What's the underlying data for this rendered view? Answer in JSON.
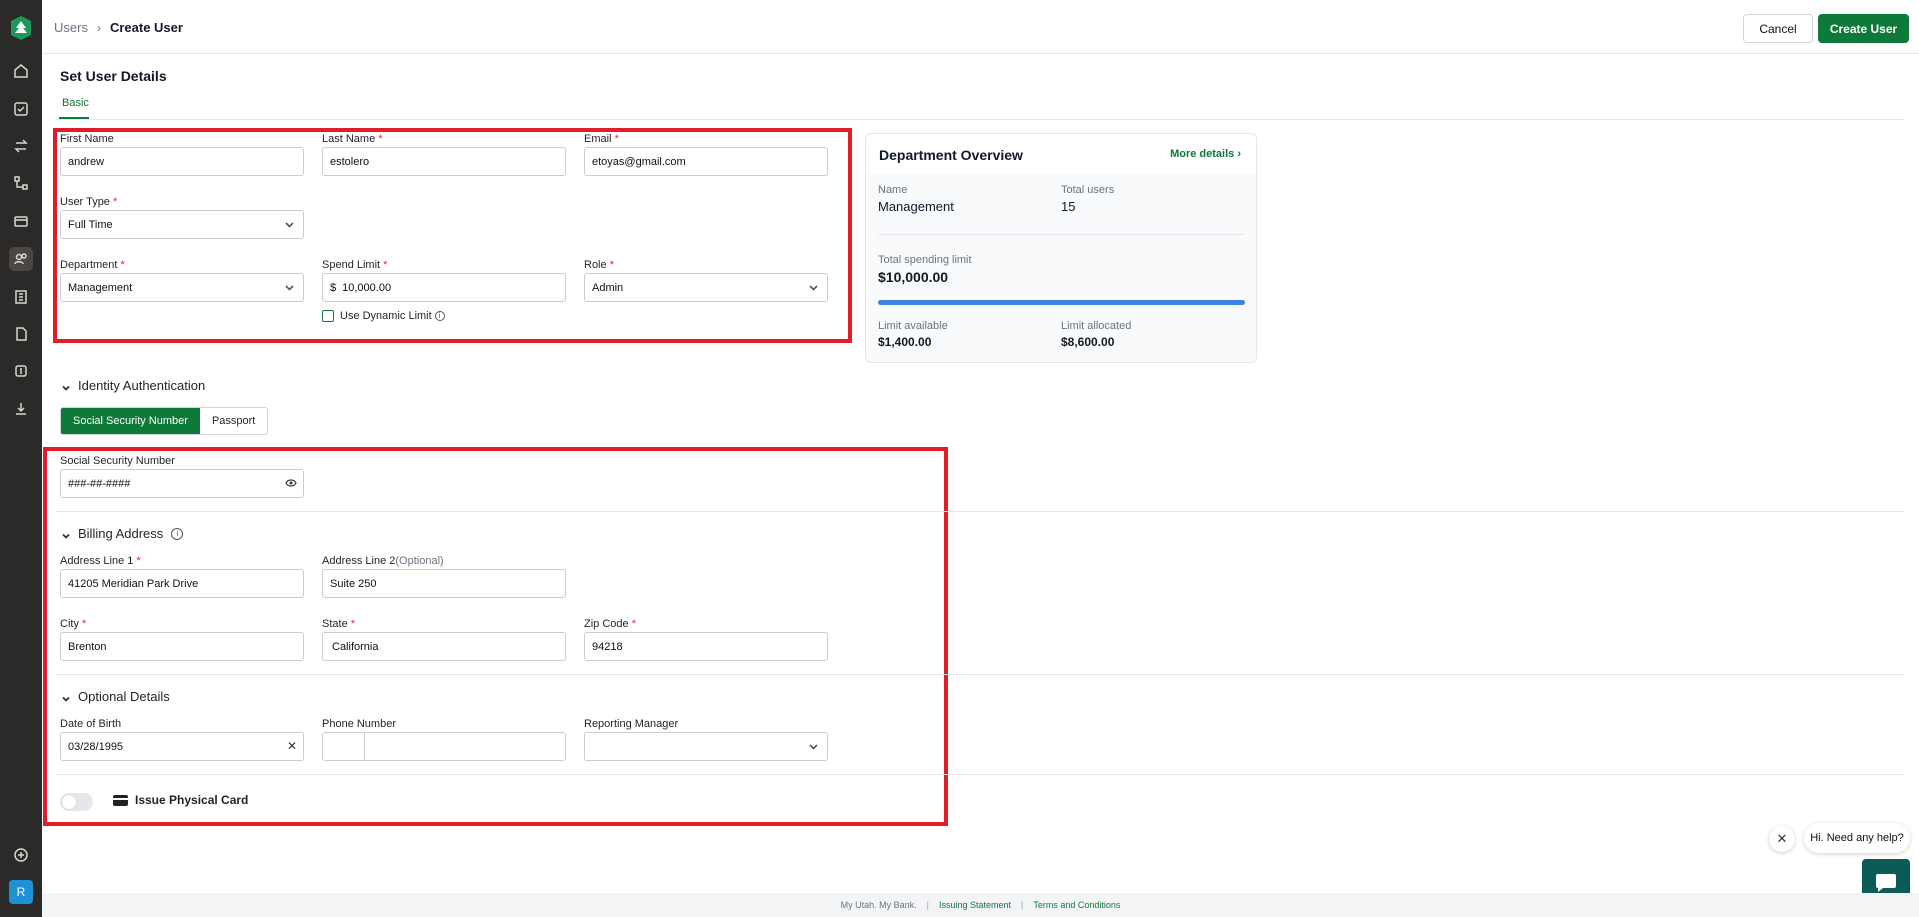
{
  "breadcrumb": {
    "parent": "Users",
    "separator": "›",
    "current": "Create User"
  },
  "header": {
    "cancel_label": "Cancel",
    "create_label": "Create User"
  },
  "page": {
    "title": "Set User Details",
    "tab_basic": "Basic"
  },
  "basic": {
    "first_name": {
      "label": "First Name",
      "value": "andrew"
    },
    "last_name": {
      "label": "Last Name",
      "value": "estolero"
    },
    "email": {
      "label": "Email",
      "value": "etoyas@gmail.com"
    },
    "user_type": {
      "label": "User Type",
      "value": "Full Time"
    },
    "department": {
      "label": "Department",
      "value": "Management"
    },
    "spend_limit": {
      "label": "Spend Limit",
      "currency": "$",
      "value": "10,000.00"
    },
    "role": {
      "label": "Role",
      "value": "Admin"
    },
    "dynamic_limit_label": "Use Dynamic Limit",
    "required_mark": "*"
  },
  "overview": {
    "title": "Department Overview",
    "more_link": "More details ›",
    "name_label": "Name",
    "name_value": "Management",
    "users_label": "Total users",
    "users_value": "15",
    "total_label": "Total spending limit",
    "total_value": "$10,000.00",
    "available_label": "Limit available",
    "available_value": "$1,400.00",
    "allocated_label": "Limit allocated",
    "allocated_value": "$8,600.00",
    "usage_fraction": 1.0
  },
  "identity": {
    "section_title": "Identity Authentication",
    "tab_ssn": "Social Security Number",
    "tab_passport": "Passport",
    "ssn_label": "Social Security Number",
    "ssn_value": "###-##-####"
  },
  "billing": {
    "section_title": "Billing Address",
    "line1_label": "Address Line 1",
    "line1_value": "41205 Meridian Park Drive",
    "line2_label": "Address Line 2",
    "line2_optional": "(Optional)",
    "line2_value": "Suite 250",
    "city_label": "City",
    "city_value": "Brenton",
    "state_label": "State",
    "state_value": "California",
    "zip_label": "Zip Code",
    "zip_value": "94218"
  },
  "optional": {
    "section_title": "Optional Details",
    "dob_label": "Date of Birth",
    "dob_value": "03/28/1995",
    "phone_label": "Phone Number",
    "phone_code": "",
    "phone_value": "",
    "manager_label": "Reporting Manager",
    "manager_value": ""
  },
  "physical_card": {
    "label": "Issue Physical Card",
    "enabled": false
  },
  "help": {
    "bubble_text": "Hi. Need any help?",
    "close": "✕"
  },
  "sidebar": {
    "avatar": "R"
  },
  "footer": {
    "text": "My Utah. My Bank.",
    "sep": "|",
    "link1": "Issuing Statement",
    "link2": "Terms and Conditions"
  },
  "colors": {
    "brand": "#0e7a39",
    "highlight": "#e01e2b",
    "sidebar": "#2c2a28",
    "progress": "#3b82e6"
  }
}
